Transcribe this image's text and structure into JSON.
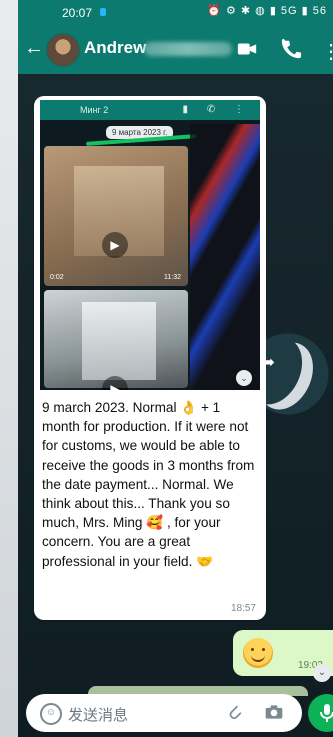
{
  "statusbar": {
    "time": "20:07",
    "icons": "⏰ ⚙ ✱ ◍ ▮ 5G ▮ 56"
  },
  "appbar": {
    "contact": "Andrew"
  },
  "forwarded": {
    "inner_name": "Минг 2",
    "date_chip": "9 марта 2023 г.",
    "video1_duration": "0:02",
    "video1_time": "11:32"
  },
  "message": {
    "text": "9 march 2023. Normal 👌 + 1 month for production. If it were not for customs, we would be able to receive the goods in 3 months from the date payment... Normal. We think about this... Thank you so much, Mrs. Ming 🥰 , for your concern. You are a great professional in your field. 🤝",
    "time": "18:57"
  },
  "outgoing": {
    "time": "19:03"
  },
  "input": {
    "placeholder": "发送消息"
  },
  "colors": {
    "header": "#0c7a6f",
    "send": "#0db157",
    "out_bubble": "#dcf8c6"
  }
}
